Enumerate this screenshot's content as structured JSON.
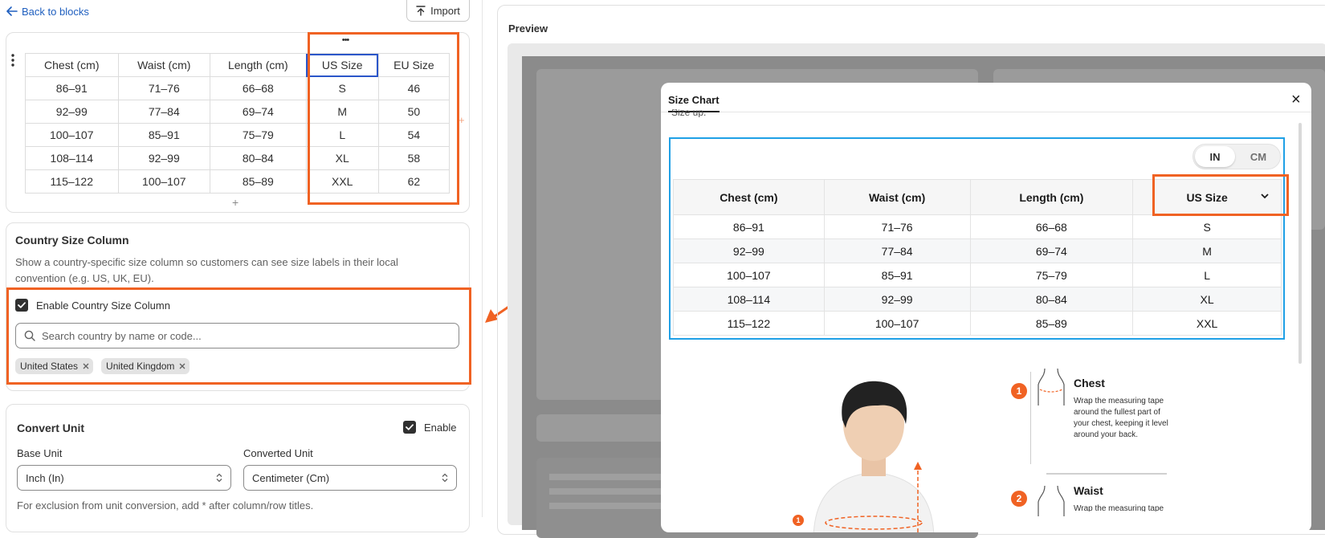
{
  "nav": {
    "back_label": "Back to blocks",
    "import_label": "Import"
  },
  "editor_table": {
    "more_label": "•••",
    "headers": [
      "Chest (cm)",
      "Waist (cm)",
      "Length (cm)",
      "US Size",
      "EU Size"
    ],
    "rows": [
      [
        "86–91",
        "71–76",
        "66–68",
        "S",
        "46"
      ],
      [
        "92–99",
        "77–84",
        "69–74",
        "M",
        "50"
      ],
      [
        "100–107",
        "85–91",
        "75–79",
        "L",
        "54"
      ],
      [
        "108–114",
        "92–99",
        "80–84",
        "XL",
        "58"
      ],
      [
        "115–122",
        "100–107",
        "85–89",
        "XXL",
        "62"
      ]
    ],
    "add_row_label": "+",
    "add_col_label": "+"
  },
  "country_section": {
    "title": "Country Size Column",
    "description": "Show a country-specific size column so customers can see size labels in their local convention (e.g. US, UK, EU).",
    "checkbox_label": "Enable Country Size Column",
    "checked": true,
    "search_placeholder": "Search country by name or code...",
    "tags": [
      "United States",
      "United Kingdom"
    ]
  },
  "convert_section": {
    "title": "Convert Unit",
    "enable_label": "Enable",
    "enabled": true,
    "base_unit_label": "Base Unit",
    "base_unit_value": "Inch (In)",
    "converted_unit_label": "Converted Unit",
    "converted_unit_value": "Centimeter (Cm)",
    "note": "For exclusion from unit conversion, add * after column/row titles."
  },
  "preview": {
    "title": "Preview",
    "modal_tab": "Size Chart",
    "close_label": "×",
    "cut_text": "Size up.",
    "unit_toggle": [
      "IN",
      "CM"
    ],
    "active_unit": "IN",
    "table": {
      "headers": [
        "Chest (cm)",
        "Waist (cm)",
        "Length (cm)",
        "US Size"
      ],
      "rows": [
        [
          "86–91",
          "71–76",
          "66–68",
          "S"
        ],
        [
          "92–99",
          "77–84",
          "69–74",
          "M"
        ],
        [
          "100–107",
          "85–91",
          "75–79",
          "L"
        ],
        [
          "108–114",
          "92–99",
          "80–84",
          "XL"
        ],
        [
          "115–122",
          "100–107",
          "85–89",
          "XXL"
        ]
      ]
    },
    "guide": [
      {
        "number": "1",
        "title": "Chest",
        "text": "Wrap the measuring tape around the fullest part of your chest, keeping it level around your back."
      },
      {
        "number": "2",
        "title": "Waist",
        "text": "Wrap the measuring tape"
      }
    ]
  },
  "colors": {
    "highlight": "#f06223",
    "link": "#1f5fbf",
    "preview_border": "#1fa0e6",
    "selected_cell": "#2b56c9"
  }
}
